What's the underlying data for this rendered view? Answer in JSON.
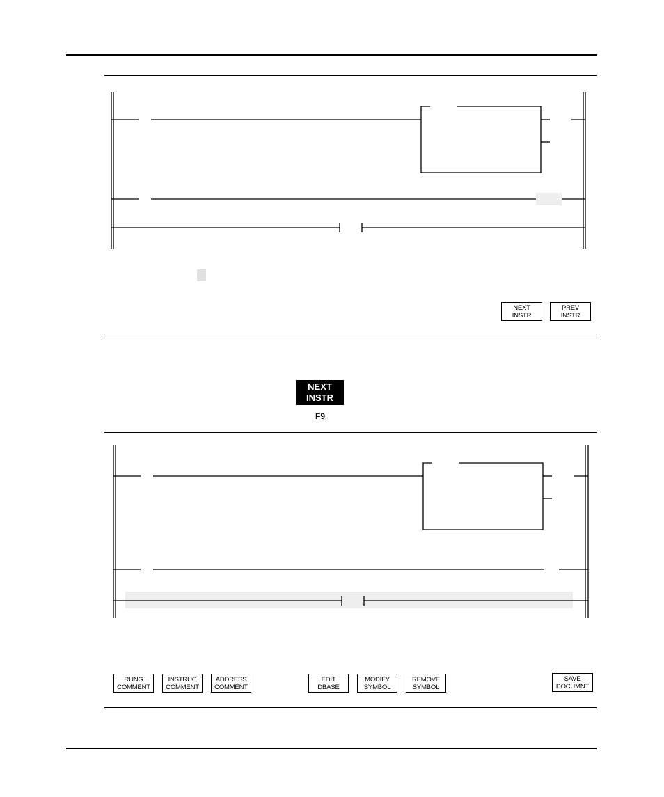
{
  "page": {
    "type": "manual-page",
    "colors": {
      "ink": "#000000",
      "highlight": "#eeeeee",
      "cursor": "#e0e0e0"
    }
  },
  "screen_before": {
    "description": "Ladder rung display with instruction block, cursor on output",
    "softkeys": [
      {
        "line1": "NEXT",
        "line2": "INSTR"
      },
      {
        "line1": "PREV",
        "line2": "INSTR"
      }
    ]
  },
  "keypress": {
    "key_line1": "NEXT",
    "key_line2": "INSTR",
    "function_key": "F9"
  },
  "screen_after": {
    "description": "Ladder rung display with cursor moved to next instruction (highlighted branch)",
    "softkeys": [
      {
        "line1": "RUNG",
        "line2": "COMMENT"
      },
      {
        "line1": "INSTRUC",
        "line2": "COMMENT"
      },
      {
        "line1": "ADDRESS",
        "line2": "COMMENT"
      },
      {
        "line1": "EDIT",
        "line2": "DBASE"
      },
      {
        "line1": "MODIFY",
        "line2": "SYMBOL"
      },
      {
        "line1": "REMOVE",
        "line2": "SYMBOL"
      },
      {
        "line1": "SAVE",
        "line2": "DOCUMNT"
      }
    ]
  }
}
